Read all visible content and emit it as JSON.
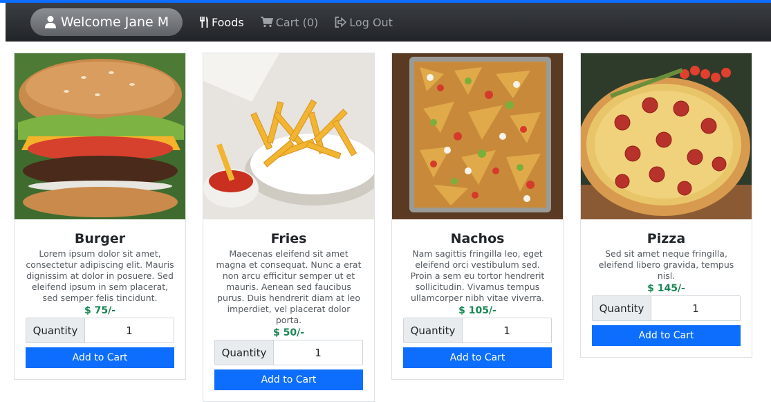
{
  "nav": {
    "welcome": "Welcome Jane M",
    "foods": "Foods",
    "cart": "Cart (0)",
    "logout": "Log Out",
    "icons": [
      "user-icon",
      "utensils-icon",
      "cart-icon",
      "logout-icon"
    ]
  },
  "products": [
    {
      "name": "Burger",
      "description": "Lorem ipsum dolor sit amet, consectetur adipiscing elit. Mauris dignissim at dolor in posuere. Sed eleifend ipsum in sem placerat, sed semper felis tincidunt.",
      "price": "$ 75/-",
      "quantity_label": "Quantity",
      "quantity": "1",
      "button": "Add to Cart"
    },
    {
      "name": "Fries",
      "description": "Maecenas eleifend sit amet magna et consequat. Nunc a erat non arcu efficitur semper ut et mauris. Aenean sed faucibus purus. Duis hendrerit diam at leo imperdiet, vel placerat dolor porta.",
      "price": "$ 50/-",
      "quantity_label": "Quantity",
      "quantity": "1",
      "button": "Add to Cart"
    },
    {
      "name": "Nachos",
      "description": "Nam sagittis fringilla leo, eget eleifend orci vestibulum sed. Proin a sem eu tortor hendrerit sollicitudin. Vivamus tempus ullamcorper nibh vitae viverra.",
      "price": "$ 105/-",
      "quantity_label": "Quantity",
      "quantity": "1",
      "button": "Add to Cart"
    },
    {
      "name": "Pizza",
      "description": "Sed sit amet neque fringilla, eleifend libero gravida, tempus nisl.",
      "price": "$ 145/-",
      "quantity_label": "Quantity",
      "quantity": "1",
      "button": "Add to Cart"
    }
  ],
  "colors": {
    "accent": "#0d6efd",
    "price": "#198754",
    "navbar": "#2b2e32"
  }
}
